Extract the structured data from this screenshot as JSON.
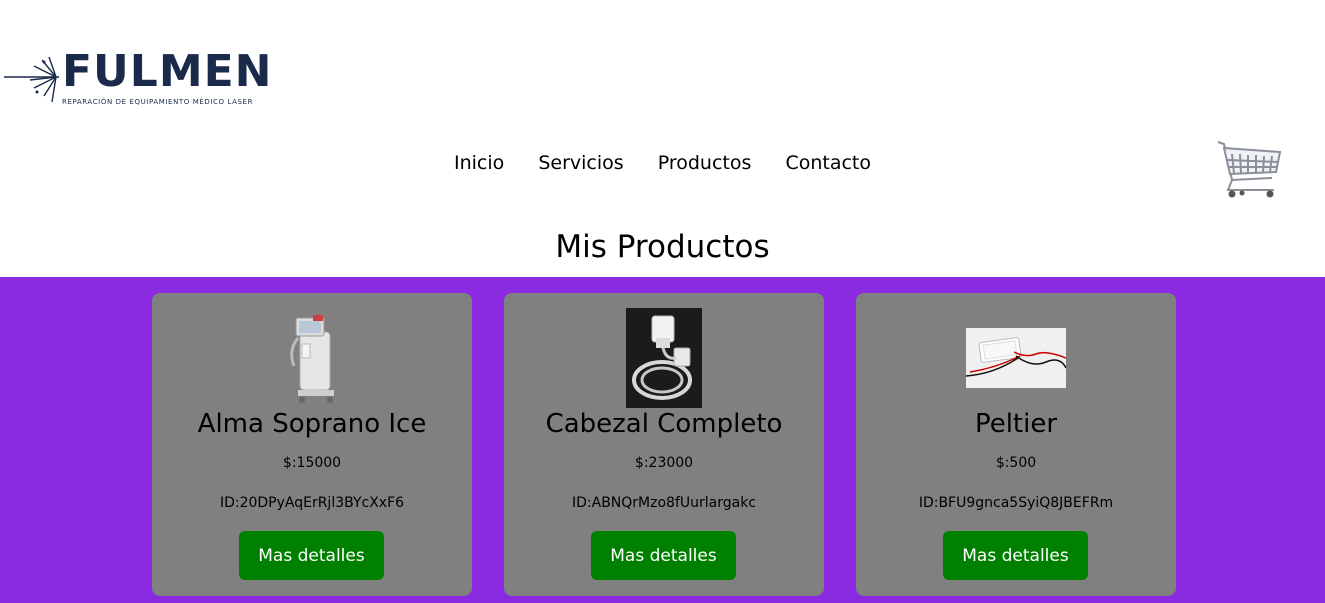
{
  "brand": {
    "name": "FULMEN",
    "tagline": "REPARACIÓN DE EQUIPAMIENTO MÉDICO LASER",
    "color": "#1a2a4a"
  },
  "nav": {
    "items": [
      "Inicio",
      "Servicios",
      "Productos",
      "Contacto"
    ]
  },
  "cart": {
    "icon": "shopping-cart-icon"
  },
  "main": {
    "title": "Mis Productos",
    "background": "#8a2be2",
    "card_background": "#808080",
    "button_color": "#008000"
  },
  "products": [
    {
      "name": "Alma Soprano Ice",
      "price": "$:15000",
      "id": "ID:20DPyAqErRjl3BYcXxF6",
      "button": "Mas detalles",
      "image": "laser-machine-image"
    },
    {
      "name": "Cabezal Completo",
      "price": "$:23000",
      "id": "ID:ABNQrMzo8fUurlargakc",
      "button": "Mas detalles",
      "image": "handpiece-cable-image"
    },
    {
      "name": "Peltier",
      "price": "$:500",
      "id": "ID:BFU9gnca5SyiQ8JBEFRm",
      "button": "Mas detalles",
      "image": "peltier-module-image"
    }
  ]
}
